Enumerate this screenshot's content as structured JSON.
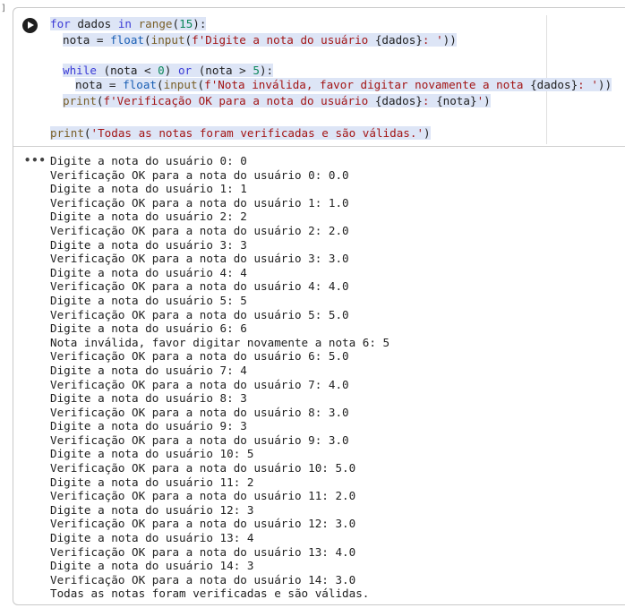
{
  "cell": {
    "exec_count": "]",
    "code_lines": [
      {
        "tokens": [
          {
            "t": "for",
            "c": "kw"
          },
          {
            "t": " dados ",
            "c": "plain"
          },
          {
            "t": "in",
            "c": "kw"
          },
          {
            "t": " ",
            "c": "plain"
          },
          {
            "t": "range",
            "c": "fn"
          },
          {
            "t": "(",
            "c": "plain"
          },
          {
            "t": "15",
            "c": "num"
          },
          {
            "t": "):",
            "c": "plain"
          }
        ],
        "indent": 0,
        "highlight": true
      },
      {
        "tokens": [
          {
            "t": "nota",
            "c": "plain"
          },
          {
            "t": " = ",
            "c": "plain"
          },
          {
            "t": "float",
            "c": "bi"
          },
          {
            "t": "(",
            "c": "plain"
          },
          {
            "t": "input",
            "c": "fn"
          },
          {
            "t": "(",
            "c": "plain"
          },
          {
            "t": "f'Digite a nota do usuário ",
            "c": "str"
          },
          {
            "t": "{dados}",
            "c": "plain"
          },
          {
            "t": ": '",
            "c": "str"
          },
          {
            "t": "))",
            "c": "plain"
          }
        ],
        "indent": 1,
        "highlight": true
      },
      {
        "tokens": [],
        "indent": 0,
        "highlight": false
      },
      {
        "tokens": [
          {
            "t": "while",
            "c": "kw"
          },
          {
            "t": " (nota < ",
            "c": "plain"
          },
          {
            "t": "0",
            "c": "num"
          },
          {
            "t": ") ",
            "c": "plain"
          },
          {
            "t": "or",
            "c": "kw"
          },
          {
            "t": " (nota > ",
            "c": "plain"
          },
          {
            "t": "5",
            "c": "num"
          },
          {
            "t": "):",
            "c": "plain"
          }
        ],
        "indent": 1,
        "highlight": true
      },
      {
        "tokens": [
          {
            "t": "nota",
            "c": "plain"
          },
          {
            "t": " = ",
            "c": "plain"
          },
          {
            "t": "float",
            "c": "bi"
          },
          {
            "t": "(",
            "c": "plain"
          },
          {
            "t": "input",
            "c": "fn"
          },
          {
            "t": "(",
            "c": "plain"
          },
          {
            "t": "f'Nota inválida, favor digitar novamente a nota ",
            "c": "str"
          },
          {
            "t": "{dados}",
            "c": "plain"
          },
          {
            "t": ": '",
            "c": "str"
          },
          {
            "t": "))",
            "c": "plain"
          }
        ],
        "indent": 2,
        "highlight": true
      },
      {
        "tokens": [
          {
            "t": "print",
            "c": "fn"
          },
          {
            "t": "(",
            "c": "plain"
          },
          {
            "t": "f'Verificação OK para a nota do usuário ",
            "c": "str"
          },
          {
            "t": "{dados}",
            "c": "plain"
          },
          {
            "t": ": ",
            "c": "str"
          },
          {
            "t": "{nota}",
            "c": "plain"
          },
          {
            "t": "'",
            "c": "str"
          },
          {
            "t": ")",
            "c": "plain"
          }
        ],
        "indent": 1,
        "highlight": true
      },
      {
        "tokens": [],
        "indent": 0,
        "highlight": false
      },
      {
        "tokens": [
          {
            "t": "print",
            "c": "fn"
          },
          {
            "t": "(",
            "c": "plain"
          },
          {
            "t": "'Todas as notas foram verificadas e são válidas.'",
            "c": "str"
          },
          {
            "t": ")",
            "c": "plain"
          }
        ],
        "indent": 0,
        "highlight": true
      }
    ]
  },
  "output": {
    "menu_icon": "more-horizontal-icon",
    "lines": [
      "Digite a nota do usuário 0: 0",
      "Verificação OK para a nota do usuário 0: 0.0",
      "Digite a nota do usuário 1: 1",
      "Verificação OK para a nota do usuário 1: 1.0",
      "Digite a nota do usuário 2: 2",
      "Verificação OK para a nota do usuário 2: 2.0",
      "Digite a nota do usuário 3: 3",
      "Verificação OK para a nota do usuário 3: 3.0",
      "Digite a nota do usuário 4: 4",
      "Verificação OK para a nota do usuário 4: 4.0",
      "Digite a nota do usuário 5: 5",
      "Verificação OK para a nota do usuário 5: 5.0",
      "Digite a nota do usuário 6: 6",
      "Nota inválida, favor digitar novamente a nota 6: 5",
      "Verificação OK para a nota do usuário 6: 5.0",
      "Digite a nota do usuário 7: 4",
      "Verificação OK para a nota do usuário 7: 4.0",
      "Digite a nota do usuário 8: 3",
      "Verificação OK para a nota do usuário 8: 3.0",
      "Digite a nota do usuário 9: 3",
      "Verificação OK para a nota do usuário 9: 3.0",
      "Digite a nota do usuário 10: 5",
      "Verificação OK para a nota do usuário 10: 5.0",
      "Digite a nota do usuário 11: 2",
      "Verificação OK para a nota do usuário 11: 2.0",
      "Digite a nota do usuário 12: 3",
      "Verificação OK para a nota do usuário 12: 3.0",
      "Digite a nota do usuário 13: 4",
      "Verificação OK para a nota do usuário 13: 4.0",
      "Digite a nota do usuário 14: 3",
      "Verificação OK para a nota do usuário 14: 3.0",
      "Todas as notas foram verificadas e são válidas."
    ]
  },
  "colors": {
    "keyword": "#3b3bd6",
    "string": "#a31515",
    "number": "#098658",
    "highlight": "#dde5f6"
  }
}
